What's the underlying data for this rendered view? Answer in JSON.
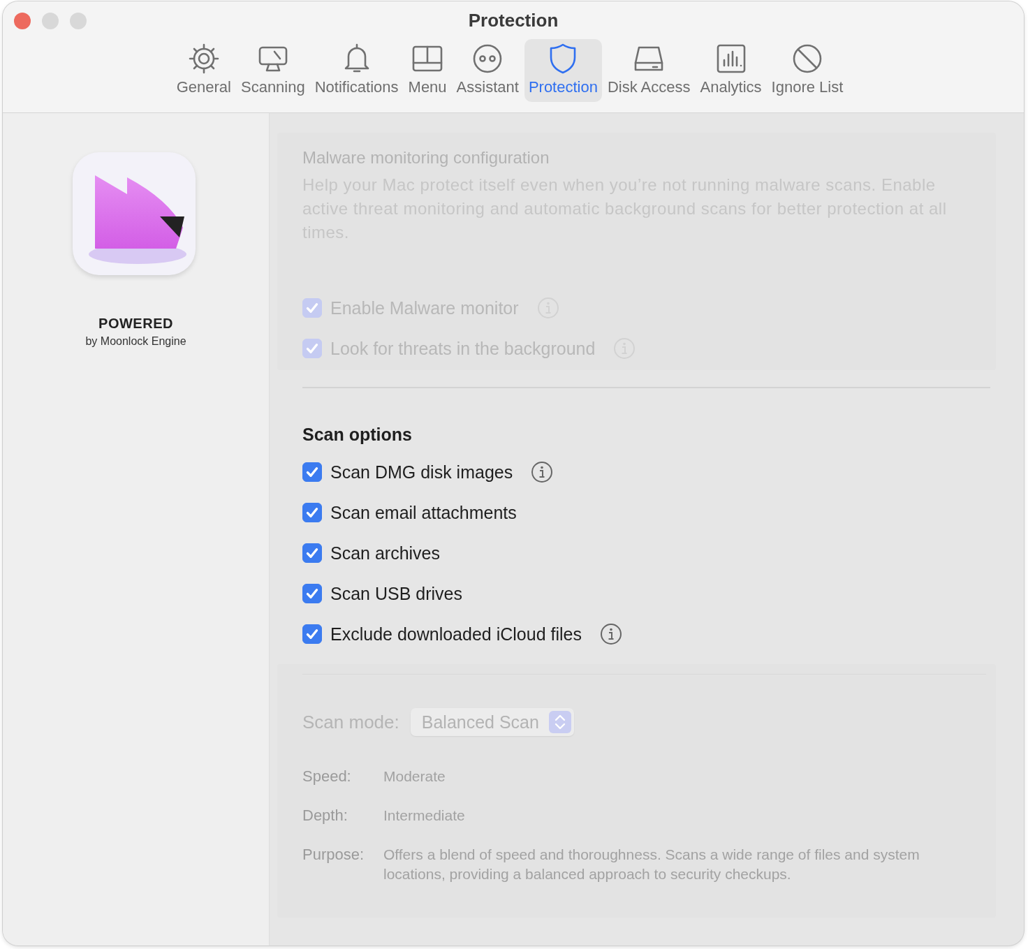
{
  "window": {
    "title": "Protection"
  },
  "tabs": [
    {
      "label": "General",
      "selected": false
    },
    {
      "label": "Scanning",
      "selected": false
    },
    {
      "label": "Notifications",
      "selected": false
    },
    {
      "label": "Menu",
      "selected": false
    },
    {
      "label": "Assistant",
      "selected": false
    },
    {
      "label": "Protection",
      "selected": true
    },
    {
      "label": "Disk Access",
      "selected": false
    },
    {
      "label": "Analytics",
      "selected": false
    },
    {
      "label": "Ignore List",
      "selected": false
    }
  ],
  "sidebar": {
    "title": "POWERED",
    "subtitle": "by Moonlock Engine"
  },
  "monitoring": {
    "disabled": true,
    "title": "Malware monitoring configuration",
    "description": "Help your Mac protect itself even when you’re not running malware scans. Enable active threat monitoring and automatic background scans for better protection at all times.",
    "options": [
      {
        "label": "Enable Malware monitor",
        "checked": true,
        "info": true
      },
      {
        "label": "Look for threats in the background",
        "checked": true,
        "info": true
      }
    ]
  },
  "scan_options": {
    "title": "Scan options",
    "options": [
      {
        "label": "Scan DMG disk images",
        "checked": true,
        "info": true
      },
      {
        "label": "Scan email attachments",
        "checked": true,
        "info": false
      },
      {
        "label": "Scan archives",
        "checked": true,
        "info": false
      },
      {
        "label": "Scan USB drives",
        "checked": true,
        "info": false
      },
      {
        "label": "Exclude downloaded iCloud files",
        "checked": true,
        "info": true
      }
    ]
  },
  "scan_mode": {
    "disabled": true,
    "label": "Scan mode:",
    "value": "Balanced Scan",
    "details": [
      {
        "label": "Speed:",
        "value": "Moderate"
      },
      {
        "label": "Depth:",
        "value": "Intermediate"
      },
      {
        "label": "Purpose:",
        "value": "Offers a blend of speed and thoroughness. Scans a wide range of files and system locations, providing a balanced approach to security checkups."
      }
    ]
  }
}
